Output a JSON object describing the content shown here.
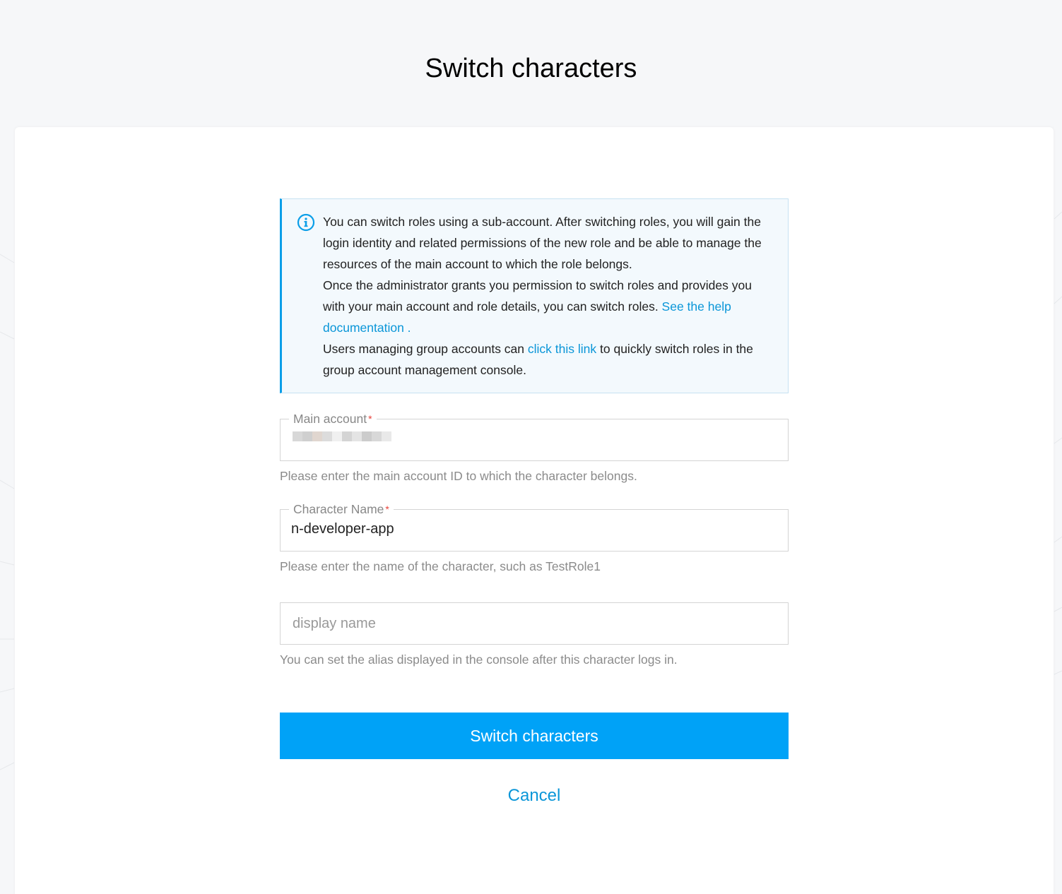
{
  "page": {
    "title": "Switch characters"
  },
  "notice": {
    "line1": "You can switch roles using a sub-account. After switching roles, you will gain the login identity and related permissions of the new role and be able to manage the resources of the main account to which the role belongs.",
    "line2_prefix": "Once the administrator grants you permission to switch roles and provides you with your main account and role details, you can switch roles. ",
    "help_link": "See the help documentation .",
    "line3_prefix": "Users managing group accounts can ",
    "click_link": "click this link",
    "line3_suffix": " to quickly switch roles in the group account management console."
  },
  "main_account": {
    "label": "Main account",
    "required_mark": "*",
    "hint": "Please enter the main account ID to which the character belongs."
  },
  "character_name": {
    "label": "Character Name",
    "required_mark": "*",
    "value": "n-developer-app",
    "hint": "Please enter the name of the character, such as TestRole1"
  },
  "display_name": {
    "placeholder": "display name",
    "hint": "You can set the alias displayed in the console after this character logs in."
  },
  "actions": {
    "submit_label": "Switch characters",
    "cancel_label": "Cancel"
  },
  "colors": {
    "accent": "#00a2f7",
    "link": "#0a96d8",
    "required": "#e8423a",
    "notice_bg": "#f3f9fd",
    "notice_border": "#0a9ee8"
  }
}
